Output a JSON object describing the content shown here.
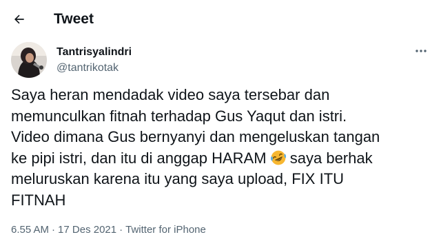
{
  "header": {
    "title": "Tweet"
  },
  "author": {
    "display_name": "Tantrisyalindri",
    "handle": "@tantrikotak"
  },
  "tweet": {
    "text_part1": "Saya heran mendadak video saya tersebar dan\nmemunculkan fitnah terhadap Gus Yaqut dan istri.\nVideo dimana Gus bernyanyi dan mengeluskan tangan\nke pipi istri, dan itu di anggap HARAM ",
    "emoji": "rolling-on-the-floor-laughing",
    "text_part2": " saya berhak\nmeluruskan karena itu yang saya upload, FIX ITU\nFITNAH"
  },
  "meta": {
    "time": "6.55 AM",
    "separator": "·",
    "date": "17 Des 2021",
    "source": "Twitter for iPhone"
  },
  "icons": {
    "back": "arrow-left-icon",
    "more": "more-horizontal-icon"
  },
  "colors": {
    "text_primary": "#0f1419",
    "text_secondary": "#536471",
    "background": "#ffffff",
    "emoji_face": "#f7b731",
    "emoji_tears": "#5dade2"
  }
}
